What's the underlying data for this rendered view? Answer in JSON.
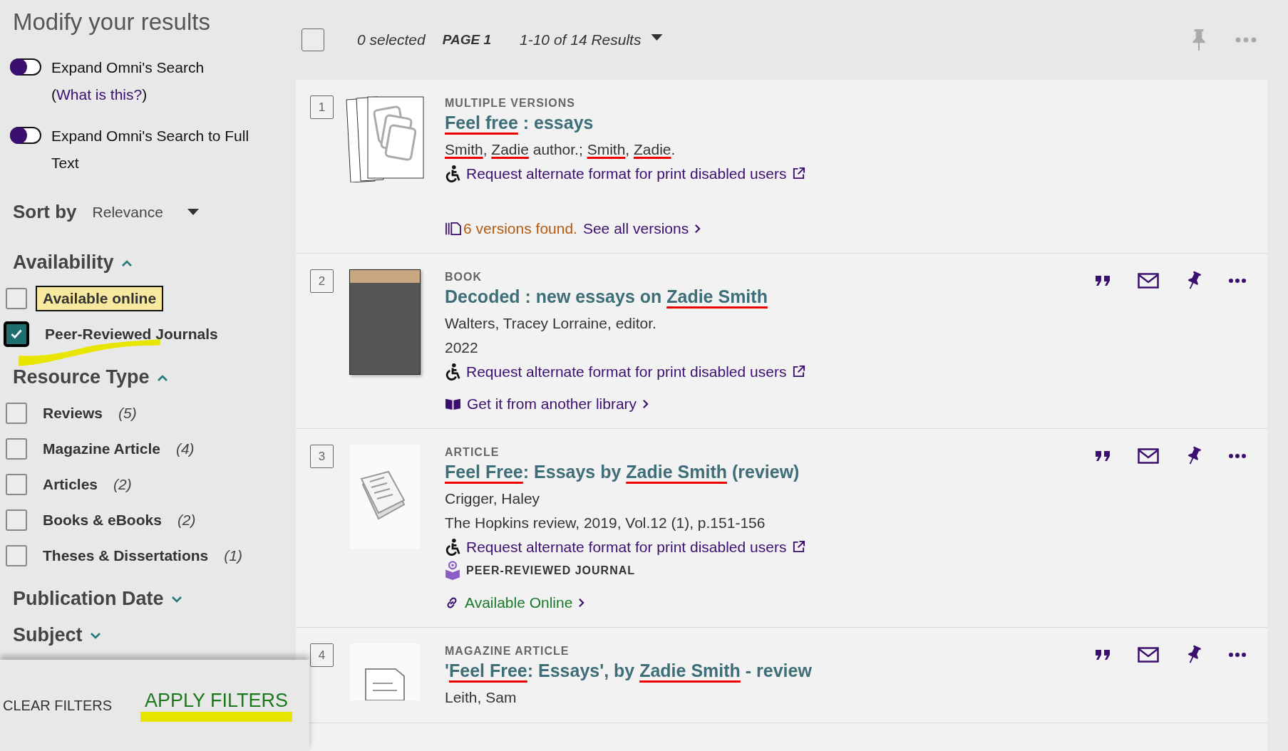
{
  "sidebar": {
    "title": "Modify your results",
    "toggles": [
      {
        "label": "Expand Omni's Search (",
        "link": "What is this?",
        "after": ")",
        "on": false
      },
      {
        "label": "Expand Omni's Search to Full Text",
        "on": false
      }
    ],
    "sort": {
      "label": "Sort by",
      "value": "Relevance"
    },
    "sections": [
      {
        "title": "Availability",
        "expanded": true,
        "items": [
          {
            "label": "Available online",
            "checked": false,
            "focused": true
          },
          {
            "label": "Peer-Reviewed Journals",
            "checked": true,
            "focused": false
          }
        ]
      },
      {
        "title": "Resource Type",
        "expanded": true,
        "items": [
          {
            "label": "Reviews",
            "count": "(5)",
            "checked": false,
            "focused": false
          },
          {
            "label": "Magazine Article",
            "count": "(4)",
            "checked": false,
            "focused": false
          },
          {
            "label": "Articles",
            "count": "(2)",
            "checked": false,
            "focused": false
          },
          {
            "label": "Books & eBooks",
            "count": "(2)",
            "checked": false,
            "focused": false
          },
          {
            "label": "Theses & Dissertations",
            "count": "(1)",
            "checked": false,
            "focused": false
          }
        ]
      },
      {
        "title": "Publication Date",
        "expanded": false
      },
      {
        "title": "Subject",
        "expanded": false
      }
    ],
    "clear_button": "CLEAR FILTERS",
    "apply_button": "APPLY FILTERS"
  },
  "toolbar": {
    "select_all_checked": false,
    "selected": "0 selected",
    "page": "PAGE 1",
    "range": "1-10 of 14 Results"
  },
  "results": [
    {
      "number": "1",
      "kind": "stack",
      "type": "MULTIPLE VERSIONS",
      "actions": false,
      "title": [
        {
          "text": "Feel free",
          "hit": true
        },
        {
          "text": " : essays",
          "hit": false
        }
      ],
      "lines": [
        {
          "kind": "authors",
          "parts": [
            {
              "text": "Smith",
              "hit": true
            },
            {
              "text": ", ",
              "hit": false
            },
            {
              "text": "Zadie",
              "hit": true
            },
            {
              "text": " author.; ",
              "hit": false
            },
            {
              "text": "Smith",
              "hit": true
            },
            {
              "text": ", ",
              "hit": false
            },
            {
              "text": "Zadie",
              "hit": true
            },
            {
              "text": ".",
              "hit": false
            }
          ]
        },
        {
          "kind": "request",
          "text": "Request alternate format for print disabled users"
        },
        {
          "kind": "versions",
          "count": "6 versions found.",
          "text": "See all versions"
        }
      ]
    },
    {
      "number": "2",
      "kind": "cover",
      "type": "BOOK",
      "actions": true,
      "title": [
        {
          "text": "Decoded : new essays on ",
          "hit": false
        },
        {
          "text": "Zadie Smith",
          "hit": true
        }
      ],
      "lines": [
        {
          "kind": "plain",
          "text": "Walters, Tracey Lorraine, editor."
        },
        {
          "kind": "plain",
          "text": "2022"
        },
        {
          "kind": "request",
          "text": "Request alternate format for print disabled users"
        },
        {
          "kind": "library",
          "text": "Get it from another library"
        }
      ]
    },
    {
      "number": "3",
      "kind": "article",
      "type": "ARTICLE",
      "actions": true,
      "title": [
        {
          "text": "Feel Free",
          "hit": true
        },
        {
          "text": ": Essays by ",
          "hit": false
        },
        {
          "text": "Zadie Smith",
          "hit": true
        },
        {
          "text": " (review)",
          "hit": false
        }
      ],
      "lines": [
        {
          "kind": "plain",
          "text": "Crigger, Haley"
        },
        {
          "kind": "plain",
          "text": "The Hopkins review, 2019, Vol.12 (1), p.151-156"
        },
        {
          "kind": "request",
          "text": "Request alternate format for print disabled users"
        },
        {
          "kind": "peer",
          "text": "PEER-REVIEWED JOURNAL"
        },
        {
          "kind": "online",
          "text": "Available Online"
        }
      ]
    },
    {
      "number": "4",
      "kind": "document",
      "type": "MAGAZINE ARTICLE",
      "actions": true,
      "title": [
        {
          "text": "'",
          "hit": false
        },
        {
          "text": "Feel Free",
          "hit": true
        },
        {
          "text": ": Essays', by ",
          "hit": false
        },
        {
          "text": "Zadie Smith",
          "hit": true
        },
        {
          "text": " - review",
          "hit": false
        }
      ],
      "lines": [
        {
          "kind": "plain",
          "text": "Leith, Sam"
        }
      ]
    }
  ]
}
